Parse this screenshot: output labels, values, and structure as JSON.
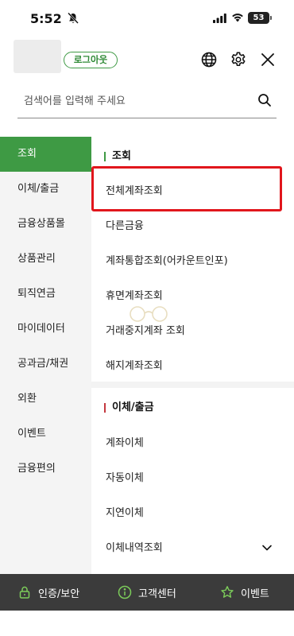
{
  "status_bar": {
    "time": "5:52",
    "battery": "53",
    "icons": [
      "bell-off-icon",
      "signal-icon",
      "wifi-icon",
      "battery-icon"
    ]
  },
  "header": {
    "logout_label": "로그아웃",
    "icons": [
      "globe-icon",
      "gear-icon",
      "close-icon"
    ]
  },
  "search": {
    "placeholder": "검색어를 입력해 주세요",
    "icon": "search-icon"
  },
  "left_menu": {
    "items": [
      {
        "label": "조회",
        "active": true
      },
      {
        "label": "이체/출금",
        "active": false
      },
      {
        "label": "금융상품몰",
        "active": false
      },
      {
        "label": "상품관리",
        "active": false
      },
      {
        "label": "퇴직연금",
        "active": false
      },
      {
        "label": "마이데이터",
        "active": false
      },
      {
        "label": "공과금/채권",
        "active": false
      },
      {
        "label": "외환",
        "active": false
      },
      {
        "label": "이벤트",
        "active": false
      },
      {
        "label": "금융편의",
        "active": false
      }
    ]
  },
  "right_menu": {
    "sections": [
      {
        "title": "조회",
        "items": [
          "전체계좌조회",
          "다른금융",
          "계좌통합조회(어카운트인포)",
          "휴면계좌조회",
          "거래중지계좌 조회",
          "해지계좌조회"
        ]
      },
      {
        "title": "이체/출금",
        "items": [
          "계좌이체",
          "자동이체",
          "지연이체",
          "이체내역조회"
        ]
      }
    ]
  },
  "bottom_bar": {
    "items": [
      {
        "label": "인증/보안",
        "icon": "lock-icon"
      },
      {
        "label": "고객센터",
        "icon": "info-icon"
      },
      {
        "label": "이벤트",
        "icon": "star-icon"
      }
    ]
  },
  "colors": {
    "accent_green": "#3e9a44",
    "highlight_red": "#e1161c",
    "bottom_bar": "#3b3b3b",
    "section_red": "#c4383f"
  }
}
